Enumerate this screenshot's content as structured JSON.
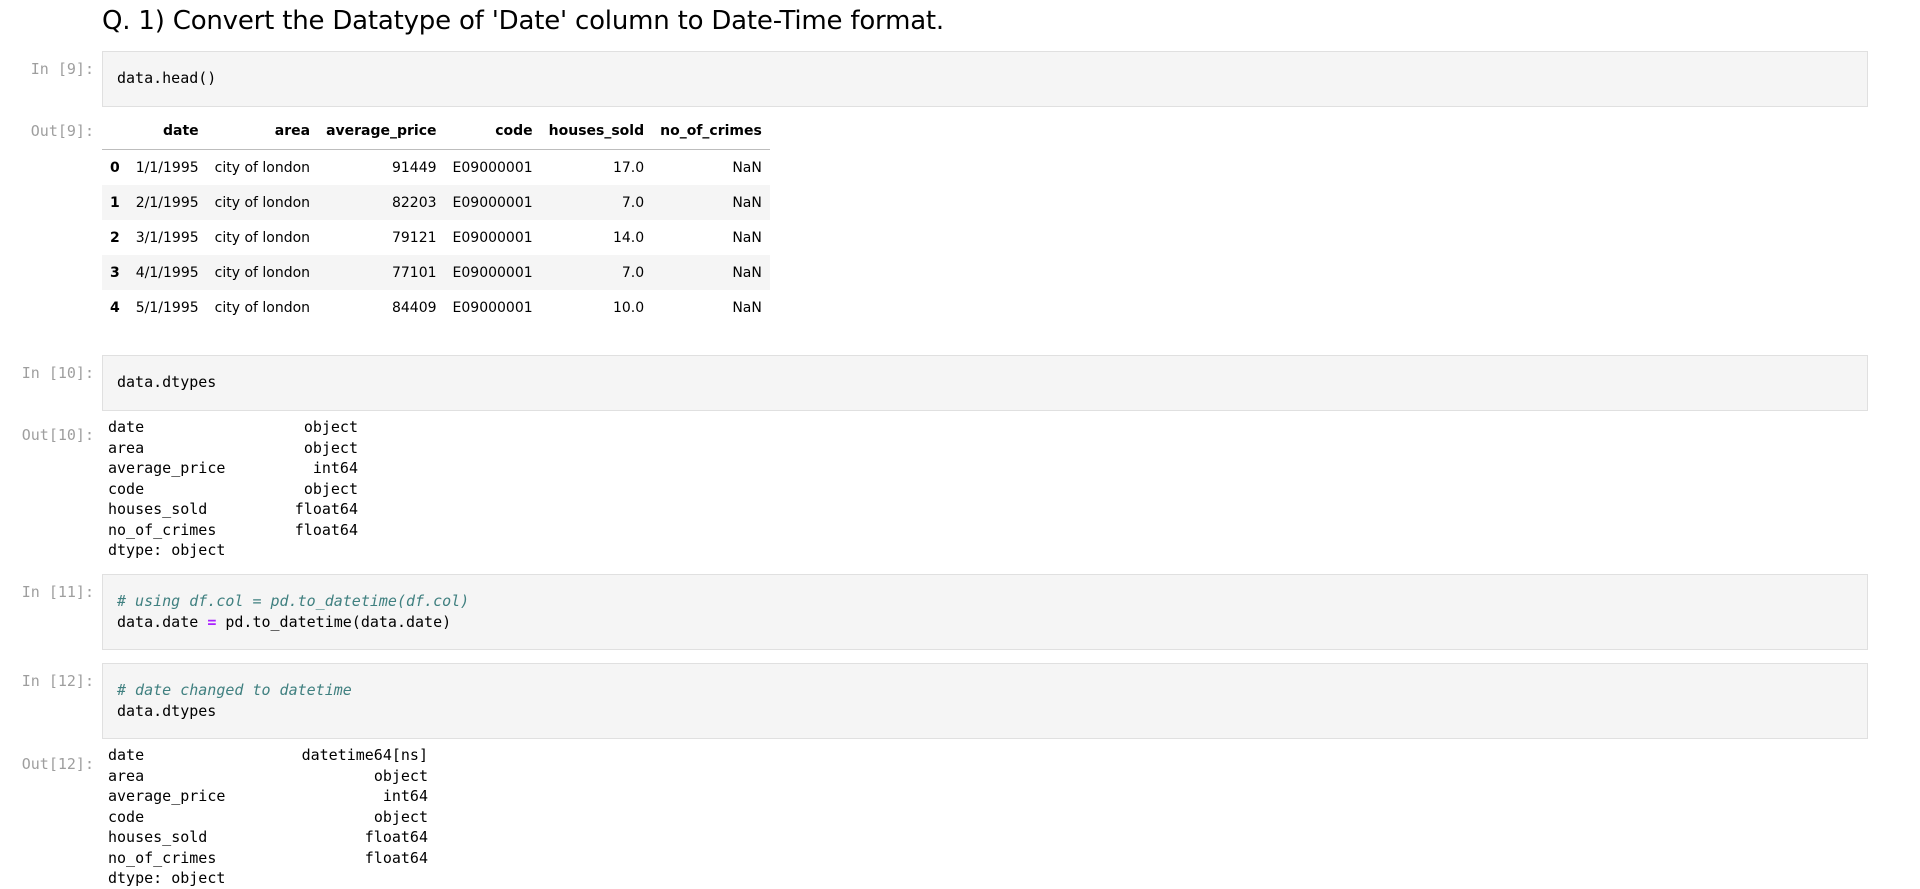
{
  "heading": "Q. 1) Convert the Datatype of 'Date' column to Date-Time format.",
  "cells": {
    "c9": {
      "prompt": "In [9]:",
      "code": "data.head()"
    },
    "o9": {
      "prompt": "Out[9]:"
    },
    "c10": {
      "prompt": "In [10]:",
      "code": "data.dtypes"
    },
    "o10": {
      "prompt": "Out[10]:"
    },
    "c11": {
      "prompt": "In [11]:",
      "comment": "# using df.col = pd.to_datetime(df.col)",
      "code_a": "data.date ",
      "op": "=",
      "code_b": " pd.to_datetime(data.date)"
    },
    "c12": {
      "prompt": "In [12]:",
      "comment": "# date changed to datetime",
      "code": "data.dtypes"
    },
    "o12": {
      "prompt": "Out[12]:"
    }
  },
  "dataframe": {
    "columns": [
      "",
      "date",
      "area",
      "average_price",
      "code",
      "houses_sold",
      "no_of_crimes"
    ],
    "rows": [
      [
        "0",
        "1/1/1995",
        "city of london",
        "91449",
        "E09000001",
        "17.0",
        "NaN"
      ],
      [
        "1",
        "2/1/1995",
        "city of london",
        "82203",
        "E09000001",
        "7.0",
        "NaN"
      ],
      [
        "2",
        "3/1/1995",
        "city of london",
        "79121",
        "E09000001",
        "14.0",
        "NaN"
      ],
      [
        "3",
        "4/1/1995",
        "city of london",
        "77101",
        "E09000001",
        "7.0",
        "NaN"
      ],
      [
        "4",
        "5/1/1995",
        "city of london",
        "84409",
        "E09000001",
        "10.0",
        "NaN"
      ]
    ]
  },
  "dtypes_before": {
    "rows": [
      [
        "date",
        "object"
      ],
      [
        "area",
        "object"
      ],
      [
        "average_price",
        "int64"
      ],
      [
        "code",
        "object"
      ],
      [
        "houses_sold",
        "float64"
      ],
      [
        "no_of_crimes",
        "float64"
      ]
    ],
    "footer": "dtype: object"
  },
  "dtypes_after": {
    "rows": [
      [
        "date",
        "datetime64[ns]"
      ],
      [
        "area",
        "object"
      ],
      [
        "average_price",
        "int64"
      ],
      [
        "code",
        "object"
      ],
      [
        "houses_sold",
        "float64"
      ],
      [
        "no_of_crimes",
        "float64"
      ]
    ],
    "footer": "dtype: object"
  }
}
